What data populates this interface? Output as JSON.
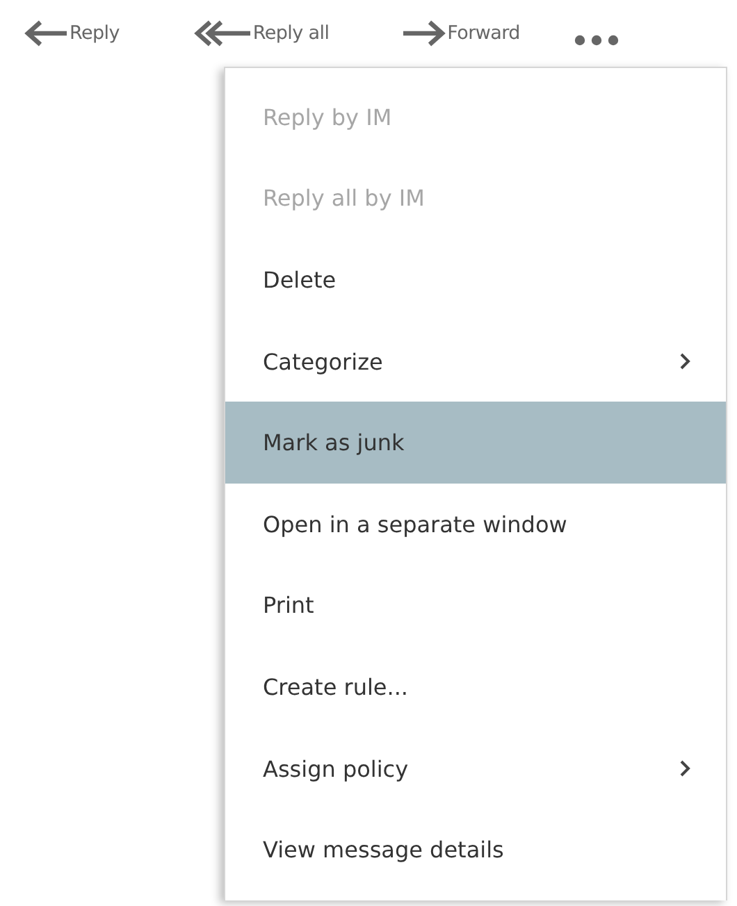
{
  "toolbar": [
    {
      "kind": "reply",
      "label": "Reply"
    },
    {
      "kind": "reply_all",
      "label": "Reply all"
    },
    {
      "kind": "forward",
      "label": "Forward"
    },
    {
      "kind": "more"
    }
  ],
  "menu": {
    "items": [
      {
        "label": "Reply by IM",
        "disabled": true,
        "selected": false,
        "submenu": false
      },
      {
        "label": "Reply all by IM",
        "disabled": true,
        "selected": false,
        "submenu": false
      },
      {
        "label": "Delete",
        "disabled": false,
        "selected": false,
        "submenu": false
      },
      {
        "label": "Categorize",
        "disabled": false,
        "selected": false,
        "submenu": true
      },
      {
        "label": "Mark as junk",
        "disabled": false,
        "selected": true,
        "submenu": false
      },
      {
        "label": "Open in a separate window",
        "disabled": false,
        "selected": false,
        "submenu": false
      },
      {
        "label": "Print",
        "disabled": false,
        "selected": false,
        "submenu": false
      },
      {
        "label": "Create rule...",
        "disabled": false,
        "selected": false,
        "submenu": false
      },
      {
        "label": "Assign policy",
        "disabled": false,
        "selected": false,
        "submenu": true
      },
      {
        "label": "View message details",
        "disabled": false,
        "selected": false,
        "submenu": false
      }
    ]
  }
}
